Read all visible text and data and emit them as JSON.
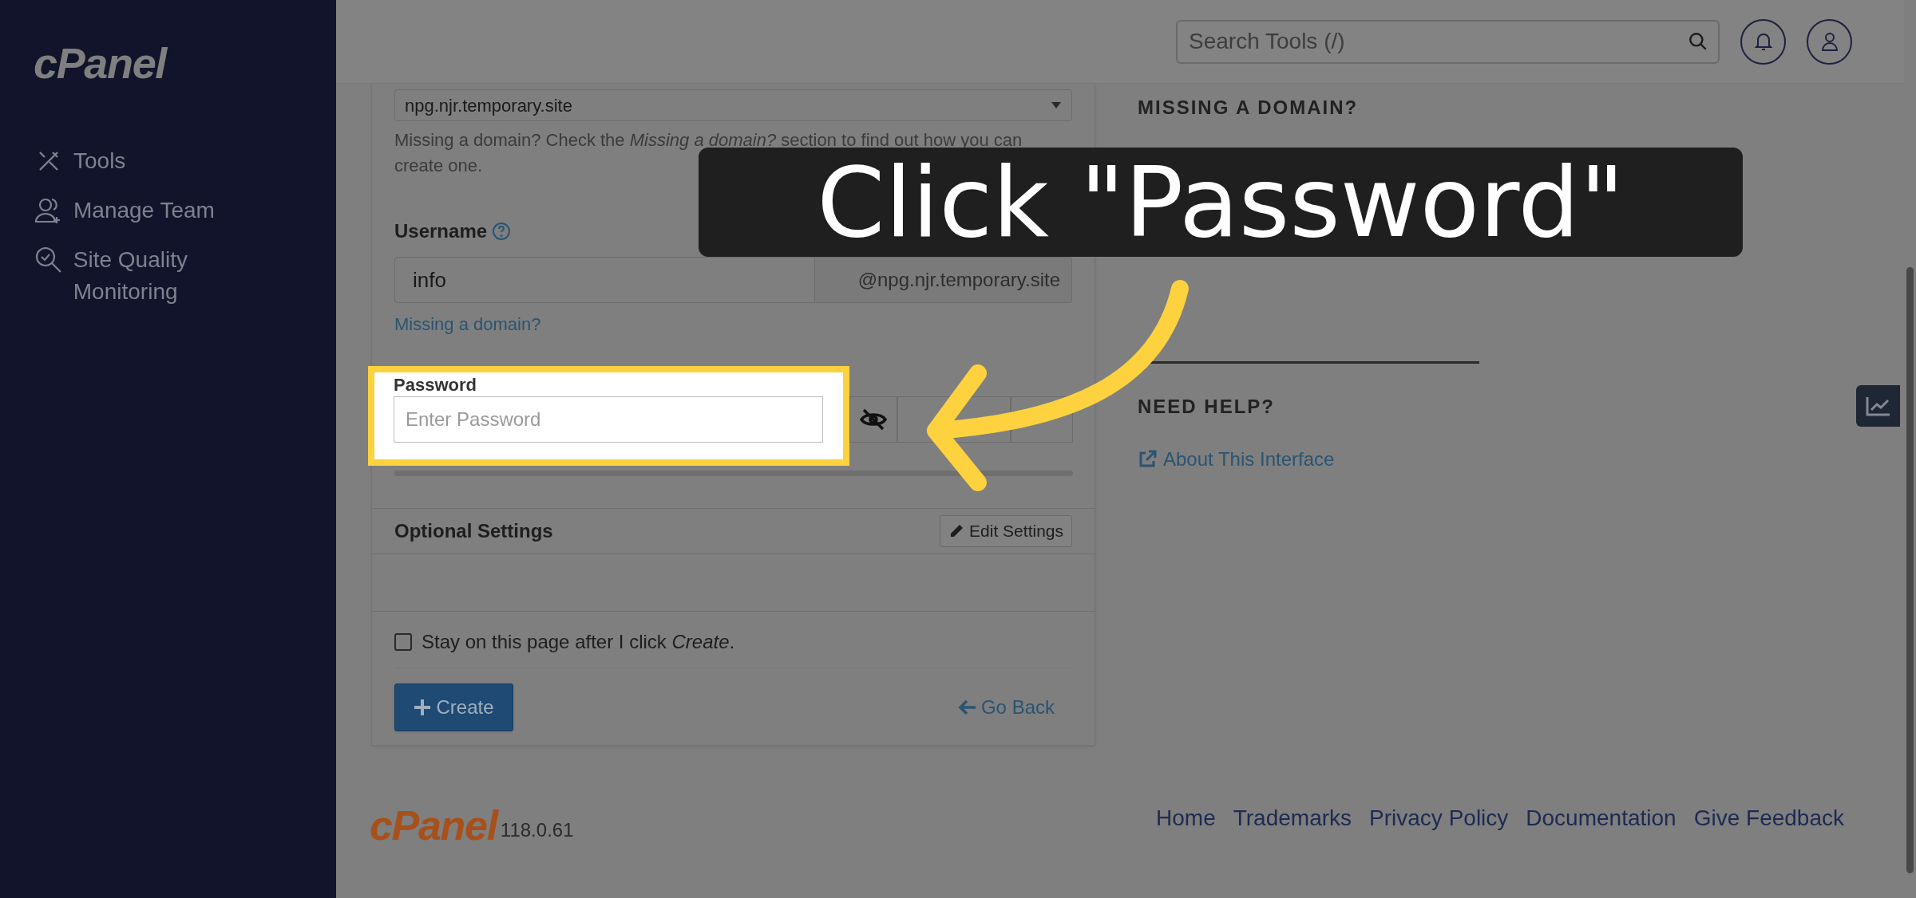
{
  "sidebar": {
    "logo": "cPanel",
    "items": [
      {
        "label": "Tools",
        "kind": "tools"
      },
      {
        "label": "Manage Team",
        "kind": "team"
      },
      {
        "label": "Site Quality Monitoring",
        "kind": "quality"
      }
    ]
  },
  "header": {
    "search": {
      "placeholder": "Search Tools (/)"
    }
  },
  "form": {
    "domain_select": {
      "value": "npg.njr.temporary.site"
    },
    "domain_help": "Missing a domain? Check the *Missing a domain?* section to find out how you can create one.",
    "username": {
      "label": "Username",
      "value": "info",
      "suffix": "@npg.njr.temporary.site",
      "link": "Missing a domain?"
    },
    "password": {
      "label": "Password",
      "placeholder": "Enter Password"
    },
    "optional_settings": {
      "title": "Optional Settings",
      "button": "Edit Settings"
    },
    "stay_checkbox": {
      "label": "Stay on this page after I click *Create*.",
      "checked": false
    },
    "create_button": "Create",
    "go_back": "Go Back"
  },
  "aside": {
    "missing_heading": "MISSING A DOMAIN?",
    "help_heading": "NEED HELP?",
    "help_link": "About This Interface"
  },
  "footer": {
    "logo": "cPanel",
    "version": "118.0.61",
    "links": [
      "Home",
      "Trademarks",
      "Privacy Policy",
      "Documentation",
      "Give Feedback"
    ]
  },
  "callout": {
    "text": "Click \"Password\""
  }
}
